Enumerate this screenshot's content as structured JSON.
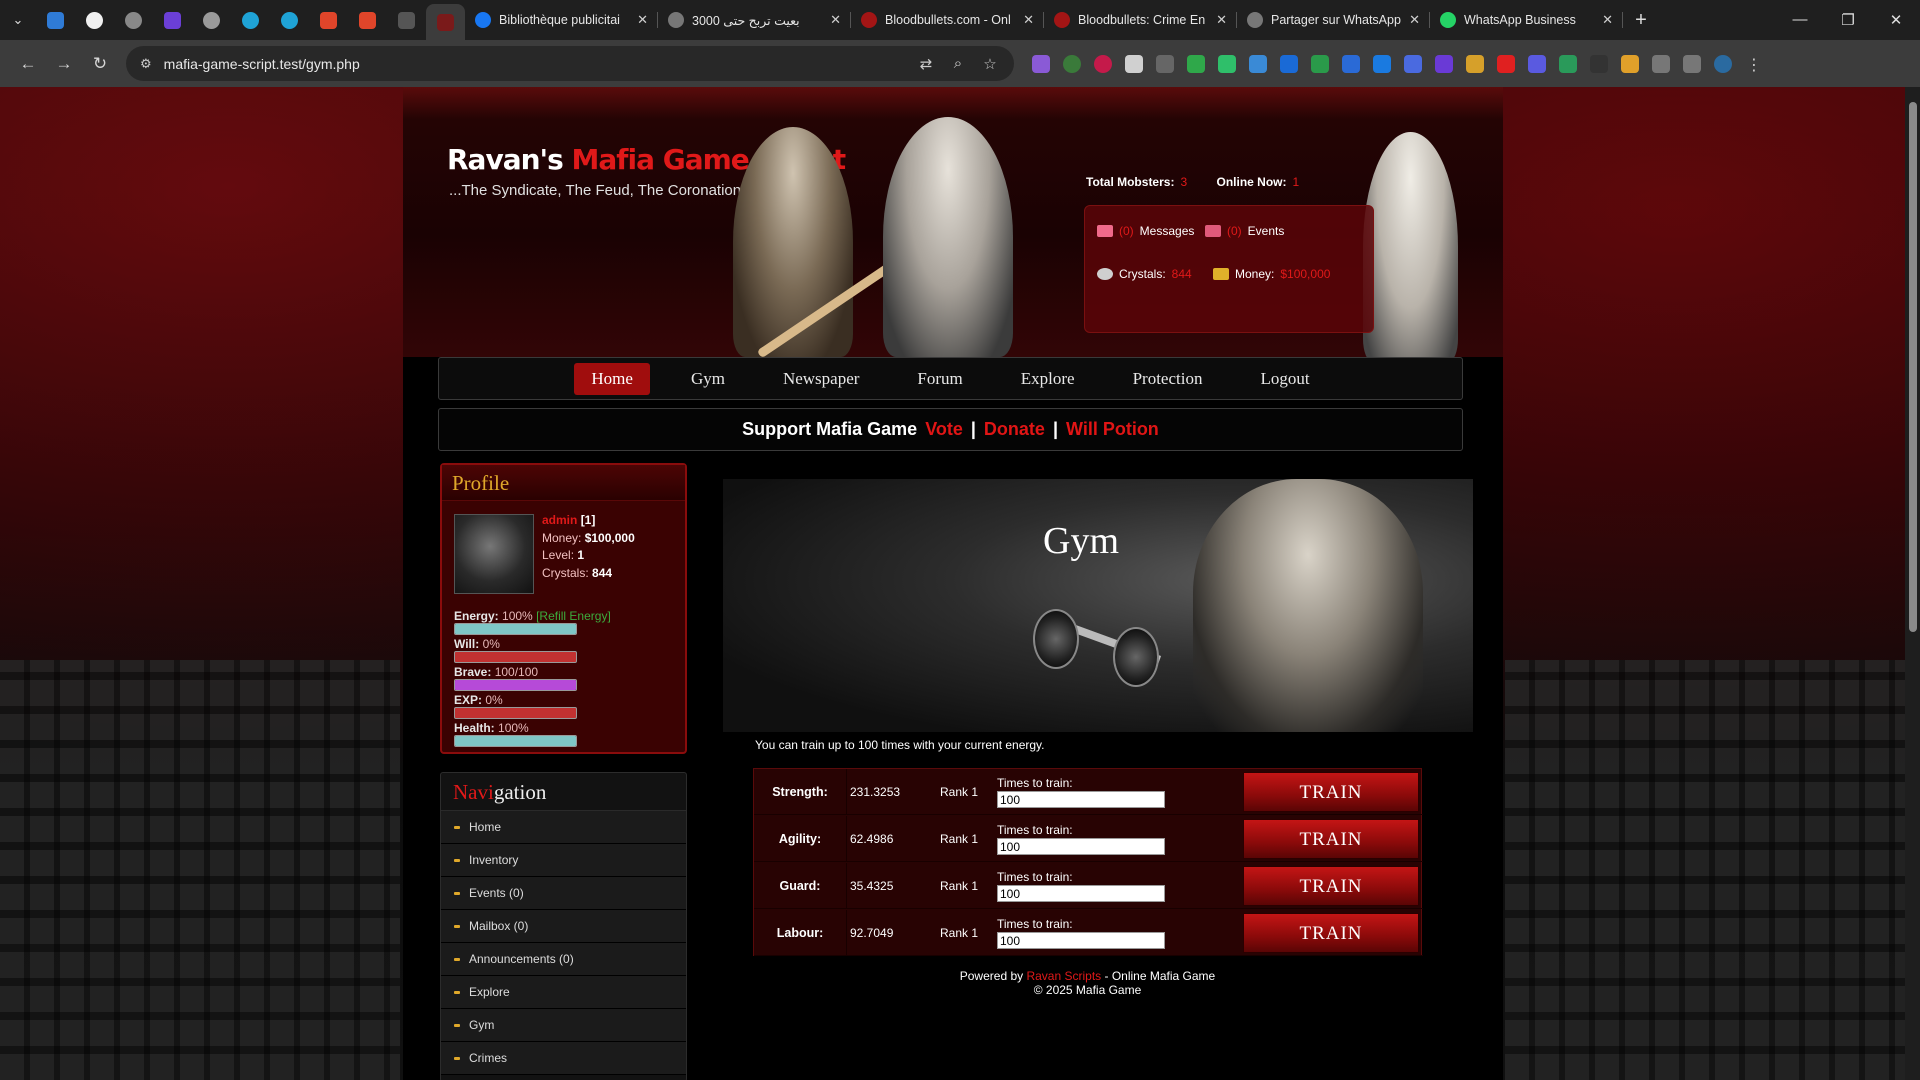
{
  "browser": {
    "tabs": [
      {
        "title": "Bibliothèque publicitai",
        "fav": "#1877f2"
      },
      {
        "title": "بعيت تربح حتى 3000",
        "fav": "#777777"
      },
      {
        "title": "Bloodbullets.com - Onl",
        "fav": "#a31515"
      },
      {
        "title": "Bloodbullets: Crime En",
        "fav": "#a31515"
      },
      {
        "title": "Partager sur WhatsApp",
        "fav": "#777777"
      },
      {
        "title": "WhatsApp Business",
        "fav": "#25d366"
      }
    ],
    "url": "mafia-game-script.test/gym.php"
  },
  "header": {
    "logo_white": "Ravan's",
    "logo_red": "Mafia Game Script",
    "tagline": "...The Syndicate, The Feud, The Coronation",
    "total_mobsters_label": "Total Mobsters:",
    "total_mobsters": "3",
    "online_now_label": "Online Now:",
    "online_now": "1",
    "messages_count": "(0)",
    "messages_label": "Messages",
    "events_count": "(0)",
    "events_label": "Events",
    "crystals_label": "Crystals:",
    "crystals": "844",
    "money_label": "Money:",
    "money": "$100,000"
  },
  "menu": [
    "Home",
    "Gym",
    "Newspaper",
    "Forum",
    "Explore",
    "Protection",
    "Logout"
  ],
  "support": {
    "text": "Support Mafia Game",
    "vote": "Vote",
    "sep": "|",
    "donate": "Donate",
    "will_potion": "Will Potion"
  },
  "profile": {
    "title": "Profile",
    "name": "admin",
    "id": "[1]",
    "money_label": "Money:",
    "money": "$100,000",
    "level_label": "Level:",
    "level": "1",
    "crystals_label": "Crystals:",
    "crystals": "844",
    "bars": [
      {
        "label": "Energy:",
        "value": "100%",
        "extra": "[Refill Energy]",
        "fill": 1.0,
        "color": "#7fc6c6"
      },
      {
        "label": "Will:",
        "value": "0%",
        "extra": "",
        "fill": 0.0,
        "color": "#c23131"
      },
      {
        "label": "Brave:",
        "value": "100/100",
        "extra": "",
        "fill": 1.0,
        "color": "#b64ad8"
      },
      {
        "label": "EXP:",
        "value": "0%",
        "extra": "",
        "fill": 0.0,
        "color": "#c23131"
      },
      {
        "label": "Health:",
        "value": "100%",
        "extra": "",
        "fill": 1.0,
        "color": "#7fc6c6"
      }
    ]
  },
  "navigation": {
    "title_red": "Navi",
    "title_rest": "gation",
    "items": [
      "Home",
      "Inventory",
      "Events (0)",
      "Mailbox (0)",
      "Announcements (0)",
      "Explore",
      "Gym",
      "Crimes"
    ]
  },
  "gym": {
    "title": "Gym",
    "message": "You can train up to 100 times with your current energy.",
    "rows": [
      {
        "stat": "Strength:",
        "value": "231.3253",
        "rank": "Rank 1",
        "times_label": "Times to train:",
        "times": "100",
        "button": "TRAIN"
      },
      {
        "stat": "Agility:",
        "value": "62.4986",
        "rank": "Rank 1",
        "times_label": "Times to train:",
        "times": "100",
        "button": "TRAIN"
      },
      {
        "stat": "Guard:",
        "value": "35.4325",
        "rank": "Rank 1",
        "times_label": "Times to train:",
        "times": "100",
        "button": "TRAIN"
      },
      {
        "stat": "Labour:",
        "value": "92.7049",
        "rank": "Rank 1",
        "times_label": "Times to train:",
        "times": "100",
        "button": "TRAIN"
      }
    ]
  },
  "footer": {
    "powered_by": "Powered by",
    "brand": "Ravan Scripts",
    "tagline": "- Online Mafia Game",
    "copyright": "© 2025 Mafia Game"
  }
}
